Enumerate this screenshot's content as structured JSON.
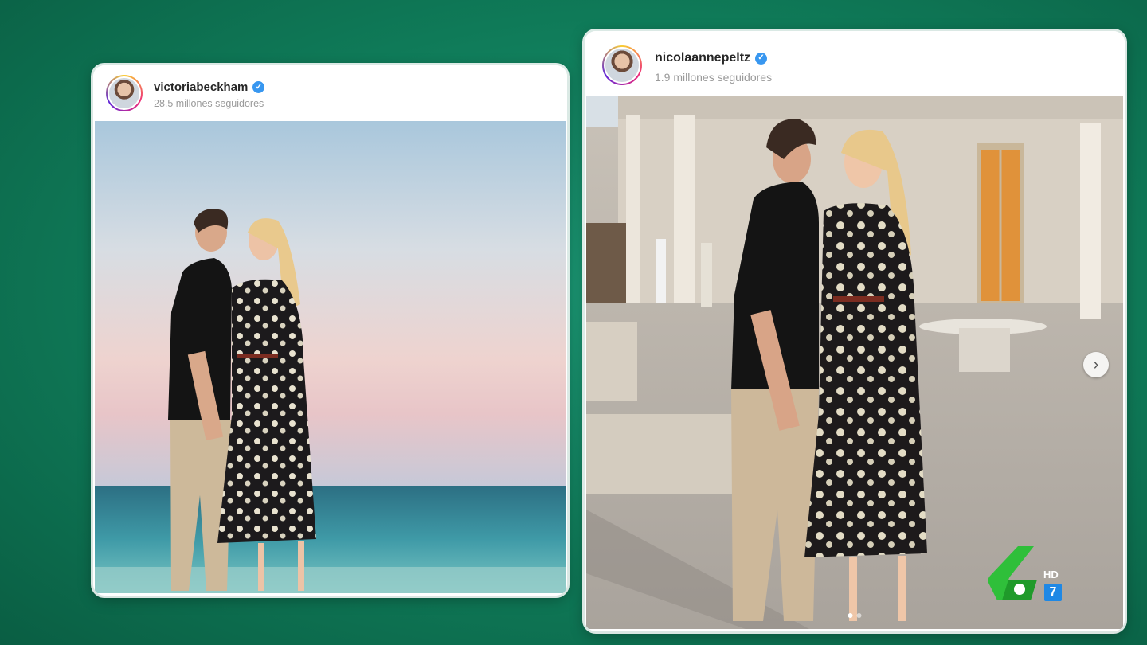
{
  "posts": [
    {
      "username": "victoriabeckham",
      "followers": "28.5 millones seguidores",
      "verified": true
    },
    {
      "username": "nicolaannepeltz",
      "followers": "1.9 millones seguidores",
      "verified": true,
      "carousel": {
        "next_icon": "chevron-right-icon",
        "pages": 2,
        "current": 1
      }
    }
  ],
  "channel": {
    "logo": "la-sexta-logo",
    "hd_label": "HD",
    "number": "7"
  },
  "colors": {
    "background": "#0f7a58",
    "verified": "#3897f0",
    "logo_green": "#2fbf3a"
  }
}
